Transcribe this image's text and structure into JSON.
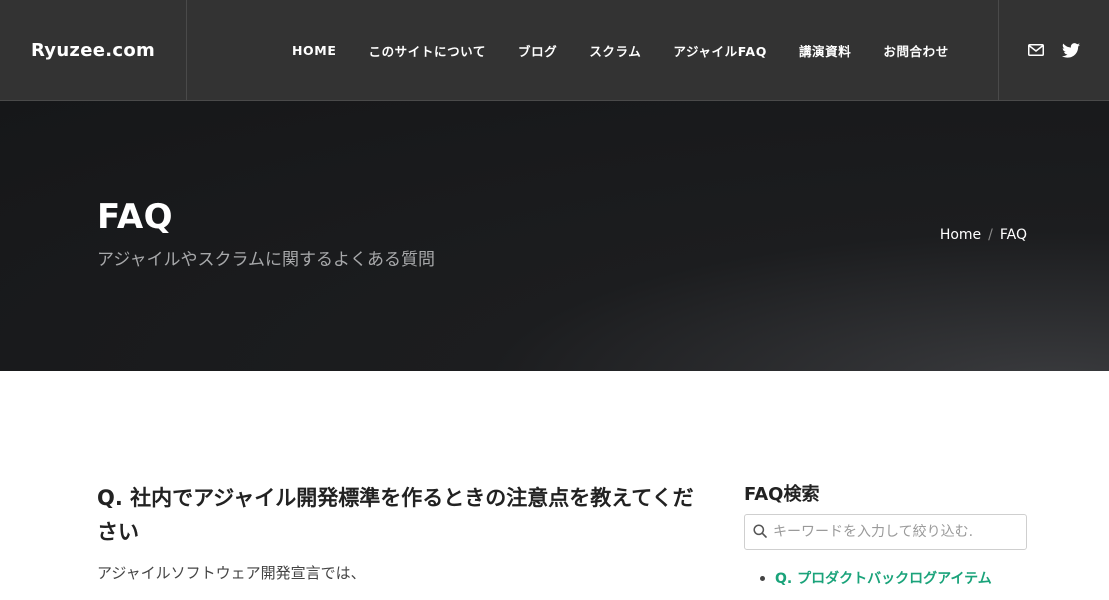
{
  "header": {
    "logo": "Ryuzee.com",
    "nav": [
      {
        "label": "HOME"
      },
      {
        "label": "このサイトについて"
      },
      {
        "label": "ブログ"
      },
      {
        "label": "スクラム"
      },
      {
        "label": "アジャイルFAQ"
      },
      {
        "label": "講演資料"
      },
      {
        "label": "お問合わせ"
      }
    ],
    "social": [
      "mail-icon",
      "twitter-icon"
    ]
  },
  "hero": {
    "title": "FAQ",
    "subtitle": "アジャイルやスクラムに関するよくある質問",
    "breadcrumb": {
      "home": "Home",
      "separator": "/",
      "current": "FAQ"
    }
  },
  "article": {
    "title": "Q. 社内でアジャイル開発標準を作るときの注意点を教えてください",
    "body": "アジャイルソフトウェア開発宣言では、"
  },
  "sidebar": {
    "title": "FAQ検索",
    "search_placeholder": "キーワードを入力して絞り込む.",
    "items": [
      {
        "label": "Q. プロダクトバックログアイテム"
      }
    ]
  },
  "colors": {
    "header_bg": "#333333",
    "hero_bg": "#161719",
    "link_accent": "#1aa37a"
  }
}
